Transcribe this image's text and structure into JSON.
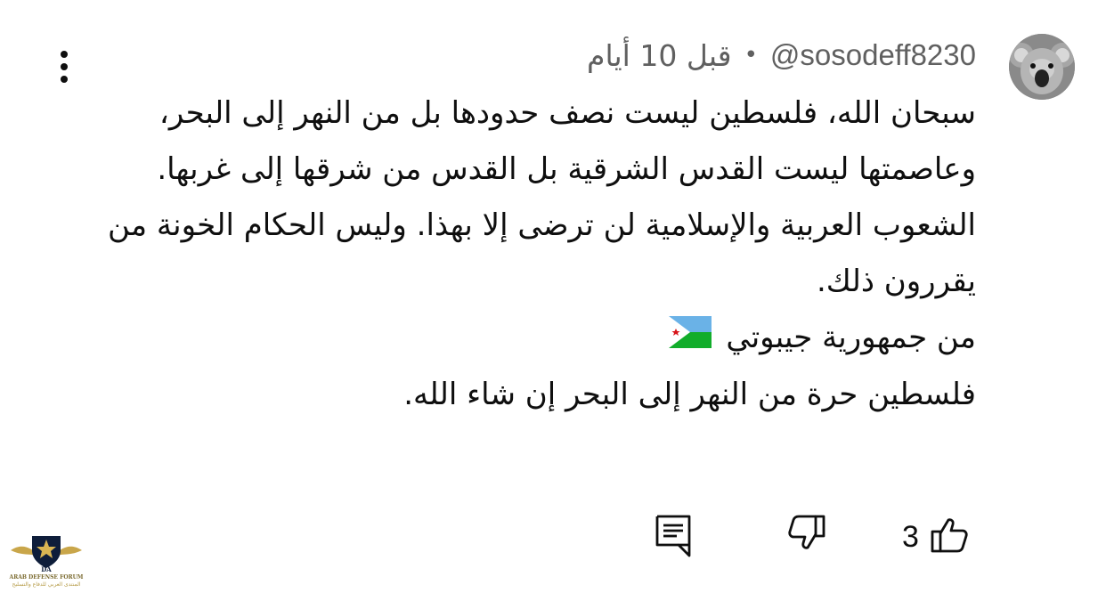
{
  "comment": {
    "author_handle": "@sosodeff8230",
    "separator": "•",
    "timestamp": "قبل 10 أيام",
    "avatar_icon": "koala-avatar",
    "lines": [
      "سبحان الله، فلسطين ليست نصف حدودها بل من النهر إلى البحر، وعاصمتها ليست القدس الشرقية بل القدس من شرقها إلى غربها.",
      "الشعوب العربية والإسلامية لن ترضى إلا بهذا. وليس الحكام الخونة من يقررون ذلك.",
      "من جمهورية جيبوتي",
      "فلسطين حرة من النهر إلى البحر إن شاء الله."
    ],
    "flag_icon": "djibouti-flag"
  },
  "actions": {
    "like_icon": "thumbs-up-icon",
    "like_count": "3",
    "dislike_icon": "thumbs-down-icon",
    "reply_icon": "reply-comment-icon"
  },
  "menu": {
    "icon": "kebab-menu-icon"
  },
  "watermark": {
    "title": "ARAB DEFENSE FORUM",
    "subtitle": "المنتدى العربي للدفاع والتسليح",
    "logo_text": "DA"
  },
  "colors": {
    "text_primary": "#0f0f0f",
    "text_secondary": "#606060",
    "background": "#ffffff"
  }
}
